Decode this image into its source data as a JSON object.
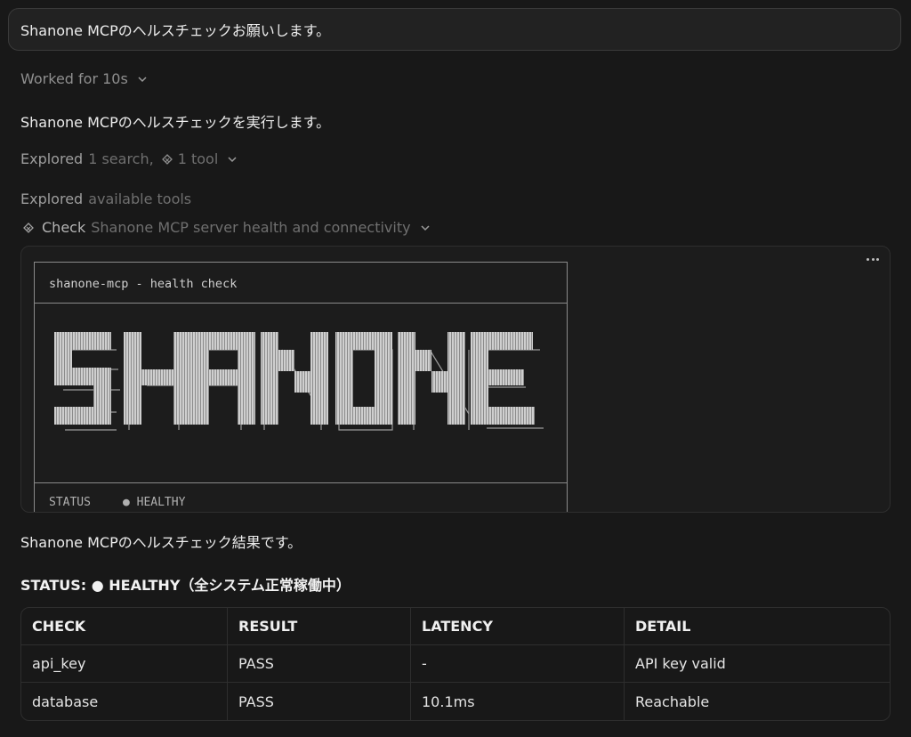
{
  "user_message": "Shanone MCPのヘルスチェックお願いします。",
  "worked_label": "Worked for 10s",
  "intro_text": "Shanone MCPのヘルスチェックを実行します。",
  "explored_summary": {
    "label": "Explored",
    "detail_a": "1 search,",
    "icon": "mcp-tool-icon",
    "detail_b": "1 tool"
  },
  "explored_tools": {
    "label": "Explored",
    "detail": "available tools"
  },
  "check_step": {
    "icon": "mcp-tool-icon",
    "label": "Check",
    "detail": "Shanone MCP server health and connectivity"
  },
  "tool_output": {
    "title": "shanone-mcp - health check",
    "status_key": "STATUS",
    "status_value": "● HEALTHY",
    "banner_letters": [
      "S",
      "H",
      "A",
      "N",
      "O",
      "N",
      "E"
    ]
  },
  "result_intro": "Shanone MCPのヘルスチェック結果です。",
  "status_line": "STATUS: ● HEALTHY（全システム正常稼働中）",
  "table": {
    "headers": [
      "CHECK",
      "RESULT",
      "LATENCY",
      "DETAIL"
    ],
    "rows": [
      [
        "api_key",
        "PASS",
        "-",
        "API key valid"
      ],
      [
        "database",
        "PASS",
        "10.1ms",
        "Reachable"
      ]
    ]
  },
  "colors": {
    "background": "#181818",
    "text": "#ededed",
    "muted": "#8f8f8f",
    "border": "#2e2e2e"
  }
}
